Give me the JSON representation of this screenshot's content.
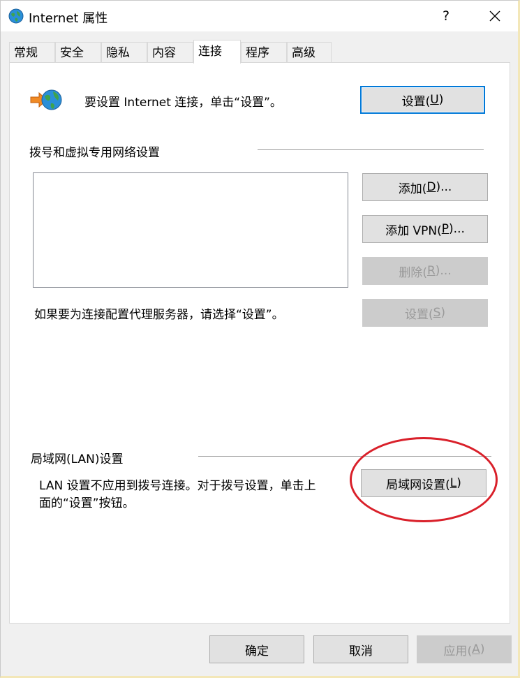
{
  "window": {
    "title": "Internet 属性",
    "help_glyph": "?",
    "icons": {
      "app": "internet-globe-icon",
      "close": "close-icon",
      "connect": "connect-wizard-icon"
    }
  },
  "tabs": [
    {
      "label": "常规",
      "active": false
    },
    {
      "label": "安全",
      "active": false
    },
    {
      "label": "隐私",
      "active": false
    },
    {
      "label": "内容",
      "active": false
    },
    {
      "label": "连接",
      "active": true
    },
    {
      "label": "程序",
      "active": false
    },
    {
      "label": "高级",
      "active": false
    }
  ],
  "setup": {
    "text": "要设置 Internet 连接，单击“设置”。",
    "button_pre": "设置(",
    "button_key": "U",
    "button_post": ")"
  },
  "dialup": {
    "heading": "拨号和虚拟专用网络设置",
    "add_pre": "添加(",
    "add_key": "D",
    "add_post": ")...",
    "addvpn_pre": "添加 VPN(",
    "addvpn_key": "P",
    "addvpn_post": ")...",
    "remove_pre": "删除(",
    "remove_key": "R",
    "remove_post": ")...",
    "proxy_text": "如果要为连接配置代理服务器，请选择“设置”。",
    "settings_pre": "设置(",
    "settings_key": "S",
    "settings_post": ")"
  },
  "lan": {
    "heading": "局域网(LAN)设置",
    "text_line1": "LAN 设置不应用到拨号连接。对于拨号设置，单击上",
    "text_line2": "面的“设置”按钮。",
    "button_pre": "局域网设置(",
    "button_key": "L",
    "button_post": ")"
  },
  "footer": {
    "ok": "确定",
    "cancel": "取消",
    "apply_pre": "应用(",
    "apply_key": "A",
    "apply_post": ")"
  },
  "colors": {
    "annotation": "#d9202a",
    "focus": "#0078d7",
    "accent_frame": "#f3e7b8"
  }
}
